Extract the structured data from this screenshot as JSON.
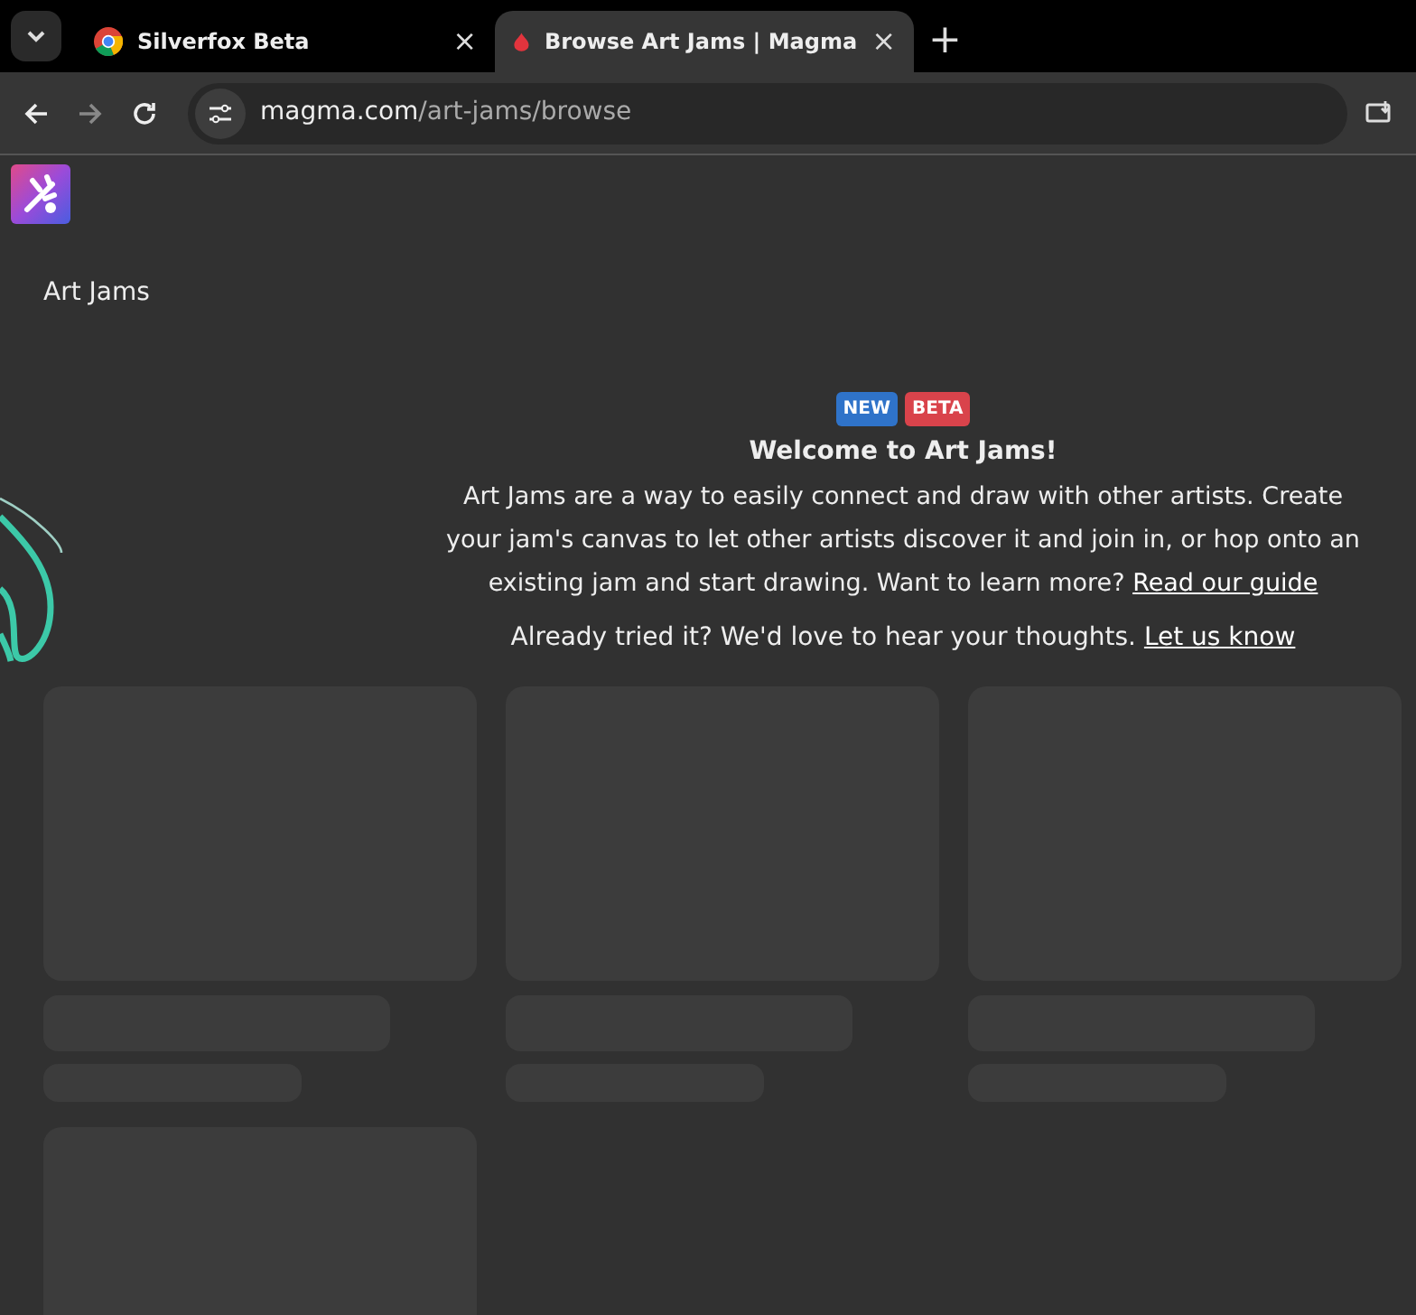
{
  "browser": {
    "tabs": [
      {
        "title": "Silverfox Beta",
        "close": "×",
        "selected": false
      },
      {
        "title": "Browse Art Jams | Magma",
        "close": "×",
        "selected": true
      }
    ],
    "new_tab": "+",
    "address": {
      "host": "magma.com",
      "path": "/art-jams/browse"
    }
  },
  "page": {
    "heading": "Art Jams",
    "badges": [
      {
        "label": "NEW",
        "color": "#2f73c9"
      },
      {
        "label": "BETA",
        "color": "#d9434b"
      }
    ],
    "welcome_title": "Welcome to Art Jams!",
    "intro": {
      "text": "Art Jams are a way to easily connect and draw with other artists. Create your jam's canvas to let other artists discover it and join in, or hop onto an existing jam and start drawing. Want to learn more?",
      "link": "Read our guide"
    },
    "feedback": {
      "text": "Already tried it? We'd love to hear your thoughts.",
      "link": "Let us know"
    },
    "loading_cards": [
      {
        "kind": "placeholder"
      },
      {
        "kind": "placeholder"
      },
      {
        "kind": "placeholder"
      },
      {
        "kind": "image_only"
      }
    ]
  }
}
